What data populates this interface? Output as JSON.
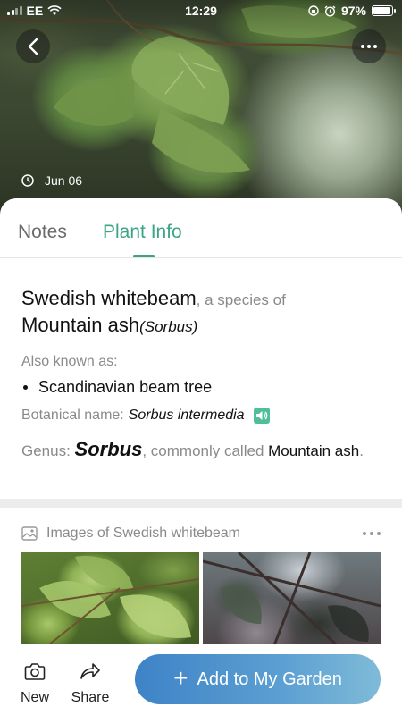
{
  "status_bar": {
    "carrier": "EE",
    "time": "12:29",
    "battery": "97%",
    "battery_level": 0.97
  },
  "hero": {
    "date": "Jun 06"
  },
  "tabs": [
    {
      "label": "Notes",
      "active": false
    },
    {
      "label": "Plant Info",
      "active": true
    }
  ],
  "plant": {
    "common_name": "Swedish whitebeam",
    "species_connector": ", a species of",
    "parent_common": "Mountain ash",
    "parent_latin": "(Sorbus)",
    "aka_label": "Also known as:",
    "aka": [
      "Scandinavian beam tree"
    ],
    "botanical_label": "Botanical name:",
    "botanical_name": "Sorbus intermedia",
    "genus_label": "Genus:",
    "genus": "Sorbus",
    "genus_connector": ", commonly called",
    "genus_common": "Mountain ash",
    "genus_end": "."
  },
  "images": {
    "heading": "Images of Swedish whitebeam"
  },
  "bottom_bar": {
    "new_label": "New",
    "share_label": "Share",
    "add_label": "Add to My Garden"
  },
  "colors": {
    "accent_green": "#3aa486",
    "button_blue": "#3e83c7"
  }
}
